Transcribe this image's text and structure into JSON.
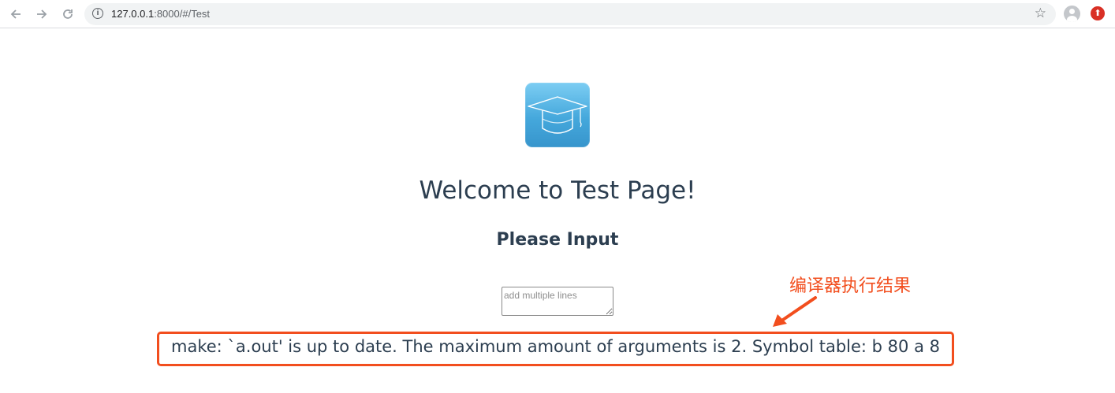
{
  "browser": {
    "back_icon": "arrow-left-icon",
    "forward_icon": "arrow-right-icon",
    "reload_icon": "reload-icon",
    "url_host": "127.0.0.1",
    "url_path": ":8000/#/Test",
    "bookmark_icon": "star-icon",
    "profile_icon": "avatar-icon",
    "extension_icon": "extension-icon"
  },
  "page": {
    "logo_icon": "graduation-cap-icon",
    "title": "Welcome to Test Page!",
    "subtitle": "Please Input",
    "input_placeholder": "add multiple lines",
    "input_value": "",
    "result_text": "make: `a.out' is up to date. The maximum amount of arguments is 2. Symbol table: b 80 a 8"
  },
  "annotation": {
    "label": "编译器执行结果",
    "color": "#f24e1e"
  }
}
